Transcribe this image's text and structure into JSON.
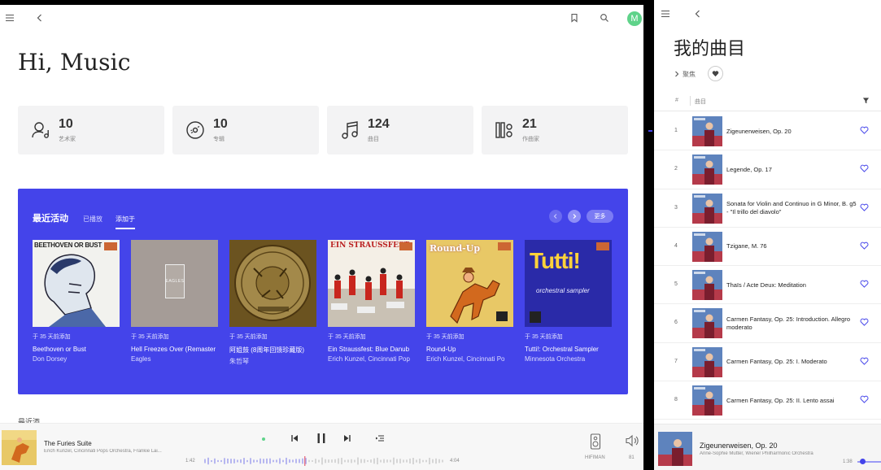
{
  "left": {
    "avatar_letter": "M",
    "greeting": "Hi, Music",
    "stats": [
      {
        "icon": "artist-icon",
        "count": "10",
        "label": "艺术家"
      },
      {
        "icon": "disc-icon",
        "count": "10",
        "label": "专辑"
      },
      {
        "icon": "music-note-icon",
        "count": "124",
        "label": "曲目"
      },
      {
        "icon": "composer-icon",
        "count": "21",
        "label": "作曲家"
      }
    ],
    "activity": {
      "title": "最近活动",
      "tabs": [
        "已播放",
        "添加于"
      ],
      "more_label": "更多",
      "albums": [
        {
          "date": "于 35 天前添加",
          "title": "Beethoven or Bust",
          "artist": "Don Dorsey",
          "cover_text": "BEETHOVEN OR BUST"
        },
        {
          "date": "于 35 天前添加",
          "title": "Hell Freezes Over (Remaster",
          "artist": "Eagles",
          "cover_text": "EAGLES"
        },
        {
          "date": "于 35 天前添加",
          "title": "阿姐鼓 (8周年回馈珍藏版)",
          "artist": "朱哲琴",
          "cover_text": ""
        },
        {
          "date": "于 35 天前添加",
          "title": "Ein Straussfest: Blue Danub",
          "artist": "Erich Kunzel, Cincinnati Pop",
          "cover_text": "EIN STRAUSSFEST"
        },
        {
          "date": "于 35 天前添加",
          "title": "Round-Up",
          "artist": "Erich Kunzel, Cincinnati Po",
          "cover_text": "Round-Up"
        },
        {
          "date": "于 35 天前添加",
          "title": "Tutti!: Orchestral Sampler",
          "artist": "Minnesota Orchestra",
          "cover_text": "Tutti!",
          "cover_sub": "orchestral sampler"
        }
      ]
    },
    "below_label": "最近添",
    "player": {
      "title": "The Furies Suite",
      "artist": "Erich Kunzel, Cincinnati Pops Orchestra, Frankie Lai...",
      "current": "1:42",
      "duration": "4:04",
      "progress": 0.42,
      "device": "HIFIMAN",
      "volume": "81"
    }
  },
  "right": {
    "title": "我的曲目",
    "focus_label": "聚焦",
    "columns": {
      "num": "#",
      "title": "曲目"
    },
    "tracks": [
      {
        "num": "1",
        "title": "Zigeunerweisen, Op. 20"
      },
      {
        "num": "2",
        "title": "Legende, Op. 17"
      },
      {
        "num": "3",
        "title": "Sonata for Violin and Continuo in G Minor, B. g5 - \"Il trillo del diavolo\""
      },
      {
        "num": "4",
        "title": "Tzigane, M. 76"
      },
      {
        "num": "5",
        "title": "Thaïs / Acte Deux: Meditation"
      },
      {
        "num": "6",
        "title": "Carmen Fantasy, Op. 25: Introduction. Allegro moderato"
      },
      {
        "num": "7",
        "title": "Carmen Fantasy, Op. 25: I. Moderato"
      },
      {
        "num": "8",
        "title": "Carmen Fantasy, Op. 25: II. Lento assai"
      }
    ],
    "player": {
      "title": "Zigeunerweisen, Op. 20",
      "artist": "Anne-Sophie Mutter, Wiener Philharmonic Orchestra",
      "time": "1:38"
    }
  },
  "colors": {
    "accent": "#4444ea",
    "avatar": "#5fd38a",
    "card": "#f3f3f4"
  }
}
